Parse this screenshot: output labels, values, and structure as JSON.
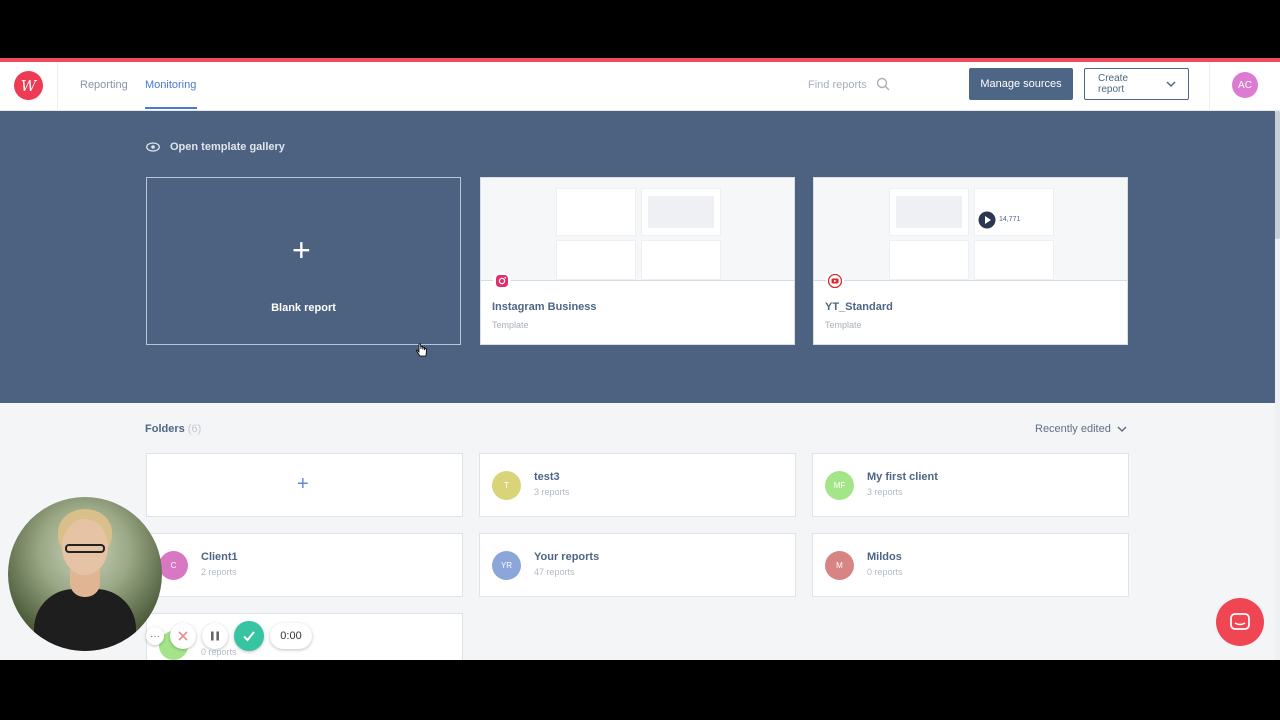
{
  "header": {
    "logo_letter": "W",
    "nav": [
      {
        "label": "Reporting",
        "active": false
      },
      {
        "label": "Monitoring",
        "active": true
      }
    ],
    "search_placeholder": "Find reports",
    "manage_sources": "Manage sources",
    "create_report": "Create report",
    "avatar_initials": "AC"
  },
  "hero": {
    "gallery_link": "Open template gallery",
    "cards": [
      {
        "title": "Blank report"
      },
      {
        "title": "Instagram Business",
        "subtitle": "Template",
        "icon": "instagram-icon"
      },
      {
        "title": "YT_Standard",
        "subtitle": "Template",
        "icon": "youtube-icon"
      }
    ],
    "thumb_yt_value": "14,771"
  },
  "folders": {
    "label": "Folders",
    "count": "(6)",
    "sort_label": "Recently edited",
    "items": [
      {
        "initials": "T",
        "name": "test3",
        "reports": "3 reports",
        "color": "#d9d37a"
      },
      {
        "initials": "MF",
        "name": "My first client",
        "reports": "3 reports",
        "color": "#a5e58a"
      },
      {
        "initials": "C",
        "name": "Client1",
        "reports": "2 reports",
        "color": "#d878c2"
      },
      {
        "initials": "YR",
        "name": "Your reports",
        "reports": "47 reports",
        "color": "#8ca6d9"
      },
      {
        "initials": "M",
        "name": "Mildos",
        "reports": "0 reports",
        "color": "#d98484"
      },
      {
        "initials": "",
        "name": "",
        "reports": "0 reports",
        "color": "#a5e58a"
      }
    ]
  },
  "recorder": {
    "timer": "0:00",
    "more": "···"
  },
  "colors": {
    "accent": "#4a78d6",
    "hero_bg": "#4c6280",
    "brand_red": "#ee3b54",
    "manage_btn": "#4d6685"
  }
}
